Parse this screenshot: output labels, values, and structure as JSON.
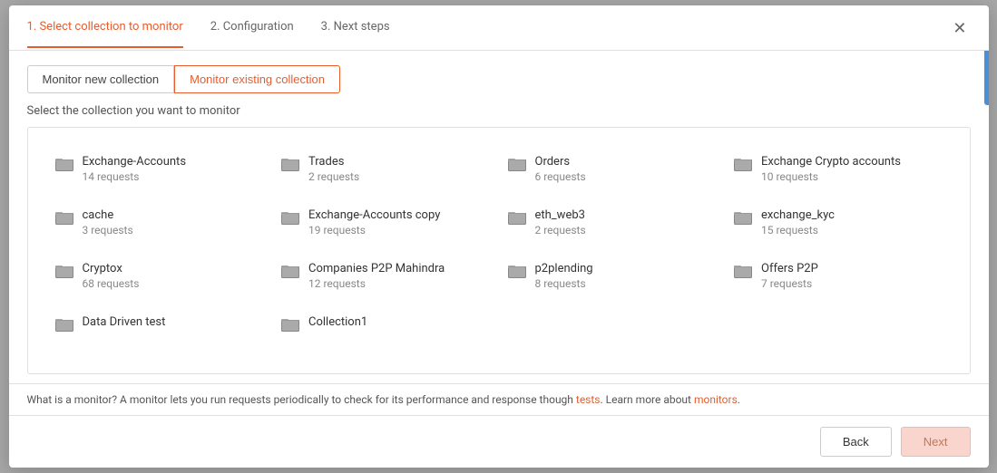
{
  "modal": {
    "steps": [
      {
        "label": "1. Select collection to monitor",
        "active": true
      },
      {
        "label": "2. Configuration",
        "active": false
      },
      {
        "label": "3. Next steps",
        "active": false
      }
    ],
    "collection_tabs": [
      {
        "label": "Monitor new collection",
        "active": false
      },
      {
        "label": "Monitor existing collection",
        "active": true
      }
    ],
    "select_label": "Select the collection you want to monitor",
    "collections": [
      {
        "name": "Exchange-Accounts",
        "count": "14 requests"
      },
      {
        "name": "Trades",
        "count": "2 requests"
      },
      {
        "name": "Orders",
        "count": "6 requests"
      },
      {
        "name": "Exchange Crypto accounts",
        "count": "10 requests"
      },
      {
        "name": "cache",
        "count": "3 requests"
      },
      {
        "name": "Exchange-Accounts copy",
        "count": "19 requests"
      },
      {
        "name": "eth_web3",
        "count": "2 requests"
      },
      {
        "name": "exchange_kyc",
        "count": "15 requests"
      },
      {
        "name": "Cryptox",
        "count": "68 requests"
      },
      {
        "name": "Companies P2P Mahindra",
        "count": "12 requests"
      },
      {
        "name": "p2plending",
        "count": "8 requests"
      },
      {
        "name": "Offers P2P",
        "count": "7 requests"
      },
      {
        "name": "Data Driven test",
        "count": ""
      },
      {
        "name": "Collection1",
        "count": ""
      }
    ],
    "footer": {
      "text_before_tests": "What is a monitor? A monitor lets you run requests periodically to check for its performance and response though ",
      "tests_link": "tests",
      "text_between": ". Learn more about ",
      "monitors_link": "monitors",
      "text_after": "."
    },
    "buttons": {
      "back": "Back",
      "next": "Next"
    }
  }
}
